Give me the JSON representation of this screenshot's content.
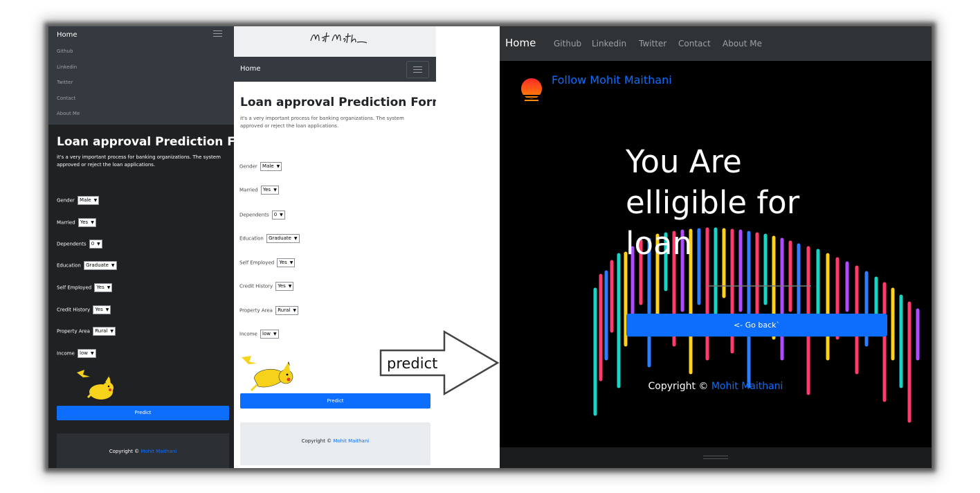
{
  "left_panel": {
    "nav": {
      "home": "Home",
      "items": [
        "Github",
        "Linkedin",
        "Twitter",
        "Contact",
        "About Me"
      ]
    },
    "title": "Loan approval Prediction Form",
    "description": "it's a very important process for banking organizations. The system approved or reject the loan applications.",
    "fields": [
      {
        "label": "Gender",
        "value": "Male"
      },
      {
        "label": "Married",
        "value": "Yes"
      },
      {
        "label": "Dependents",
        "value": "0"
      },
      {
        "label": "Education",
        "value": "Graduate"
      },
      {
        "label": "Self Employed",
        "value": "Yes"
      },
      {
        "label": "Credit History",
        "value": "Yes"
      },
      {
        "label": "Property Area",
        "value": "Rural"
      },
      {
        "label": "Income",
        "value": "low"
      }
    ],
    "predict_button": "Predict",
    "footer": {
      "prefix": "Copyright ©",
      "author": "Mohit Maithani"
    }
  },
  "middle_panel": {
    "nav": {
      "home": "Home"
    },
    "title": "Loan approval Prediction Form",
    "description": "it's a very important process for banking organizations. The system approved or reject the loan applications.",
    "fields": [
      {
        "label": "Gender",
        "value": "Male"
      },
      {
        "label": "Married",
        "value": "Yes"
      },
      {
        "label": "Dependents",
        "value": "0"
      },
      {
        "label": "Education",
        "value": "Graduate"
      },
      {
        "label": "Self Employed",
        "value": "Yes"
      },
      {
        "label": "Credit History",
        "value": "Yes"
      },
      {
        "label": "Property Area",
        "value": "Rural"
      },
      {
        "label": "Income",
        "value": "low"
      }
    ],
    "predict_button": "Predict",
    "footer": {
      "prefix": "Copyright ©",
      "author": "Mohit Maithani"
    }
  },
  "arrow": {
    "label": "predict"
  },
  "right_panel": {
    "nav": {
      "home": "Home",
      "items": [
        "Github",
        "Linkedin",
        "Twitter",
        "Contact",
        "About Me"
      ]
    },
    "follow": "Follow Mohit Maithani",
    "result_lines": [
      "You Are",
      "elligible for",
      "loan"
    ],
    "go_back_button": "<- Go back`",
    "footer": {
      "prefix": "Copyright ©",
      "author": "Mohit Maithani"
    }
  },
  "colors": {
    "accent": "#0d6efd",
    "dark_bg": "#1f2123",
    "navbar": "#353a40",
    "result_bg": "#000000"
  }
}
